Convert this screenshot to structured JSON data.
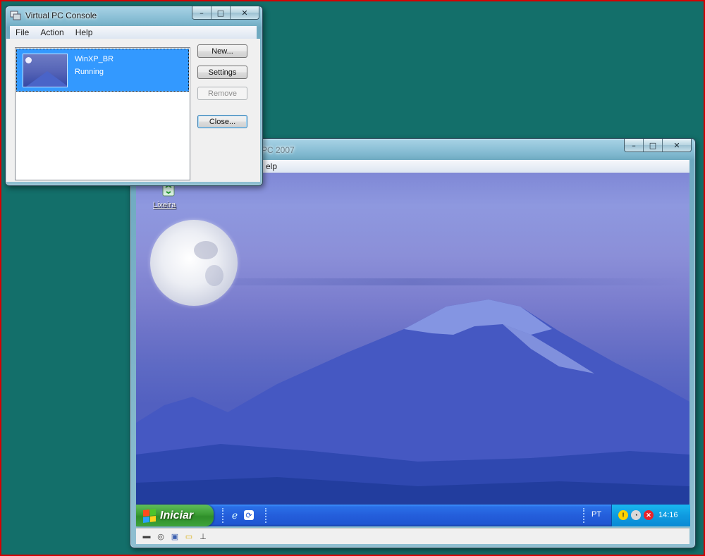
{
  "console": {
    "title": "Virtual PC Console",
    "menu": [
      "File",
      "Action",
      "Help"
    ],
    "vm_name": "WinXP_BR",
    "vm_status": "Running",
    "buttons": {
      "new": "New...",
      "settings": "Settings",
      "remove": "Remove",
      "close": "Close..."
    },
    "icon": "virtual-pc-icon"
  },
  "vm_window": {
    "title": "PC 2007",
    "menu_fragment": "elp",
    "controls": {
      "minimize": "–",
      "maximize": "□",
      "close": "✕"
    }
  },
  "guest": {
    "desktop_icon_label": "Lixeira",
    "start_label": "Iniciar",
    "language": "PT",
    "clock": "14:16",
    "quick_launch": [
      "internet-explorer-icon",
      "media-icon"
    ],
    "tray_icons": [
      "security-alert-icon",
      "network-icon",
      "firewall-warning-icon"
    ]
  },
  "status_icons": [
    "hard-disk-icon",
    "cd-icon",
    "floppy-icon",
    "shared-folder-icon",
    "network-adapter-icon"
  ],
  "colors": {
    "selection": "#3399ff",
    "desktop": "#136f6a",
    "taskbar": "#245edb",
    "start": "#3b9d34"
  }
}
